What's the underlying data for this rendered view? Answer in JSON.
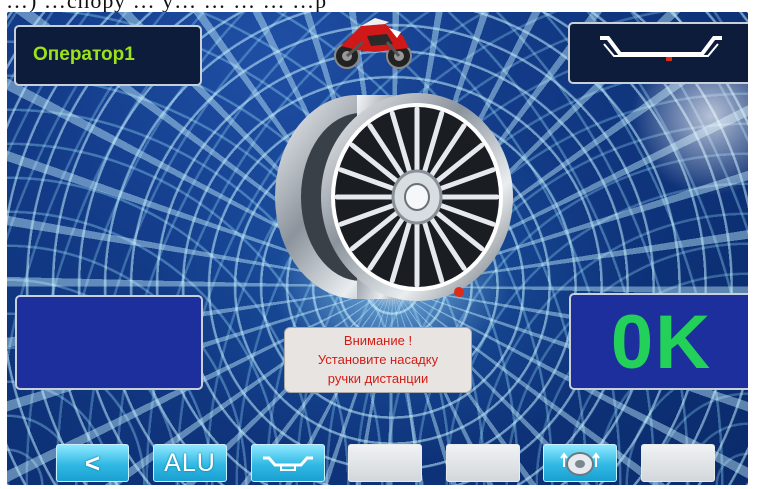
{
  "top_strip_text": "…) …спору … у… … … … …р",
  "operator_label": "Оператор1",
  "status": {
    "value": "0K",
    "color": "#23d05a"
  },
  "warning": {
    "line1": "Внимание !",
    "line2": "Установите насадку",
    "line3": "ручки дистанции"
  },
  "toolbar": {
    "back_label": "<",
    "alu_label": "ALU"
  },
  "icons": {
    "motorcycle": "motorcycle-icon",
    "rim_profile": "rim-profile-icon",
    "wheel": "wheel-rim-icon",
    "rim_measure": "rim-measure-icon",
    "balance": "balance-weight-icon"
  },
  "colors": {
    "operator_text": "#9ae21a",
    "warning_text": "#d21c14",
    "accent_blue": "#1c2f9c",
    "button_cyan": "#31b9e4",
    "marker_red": "#e02a1a"
  }
}
